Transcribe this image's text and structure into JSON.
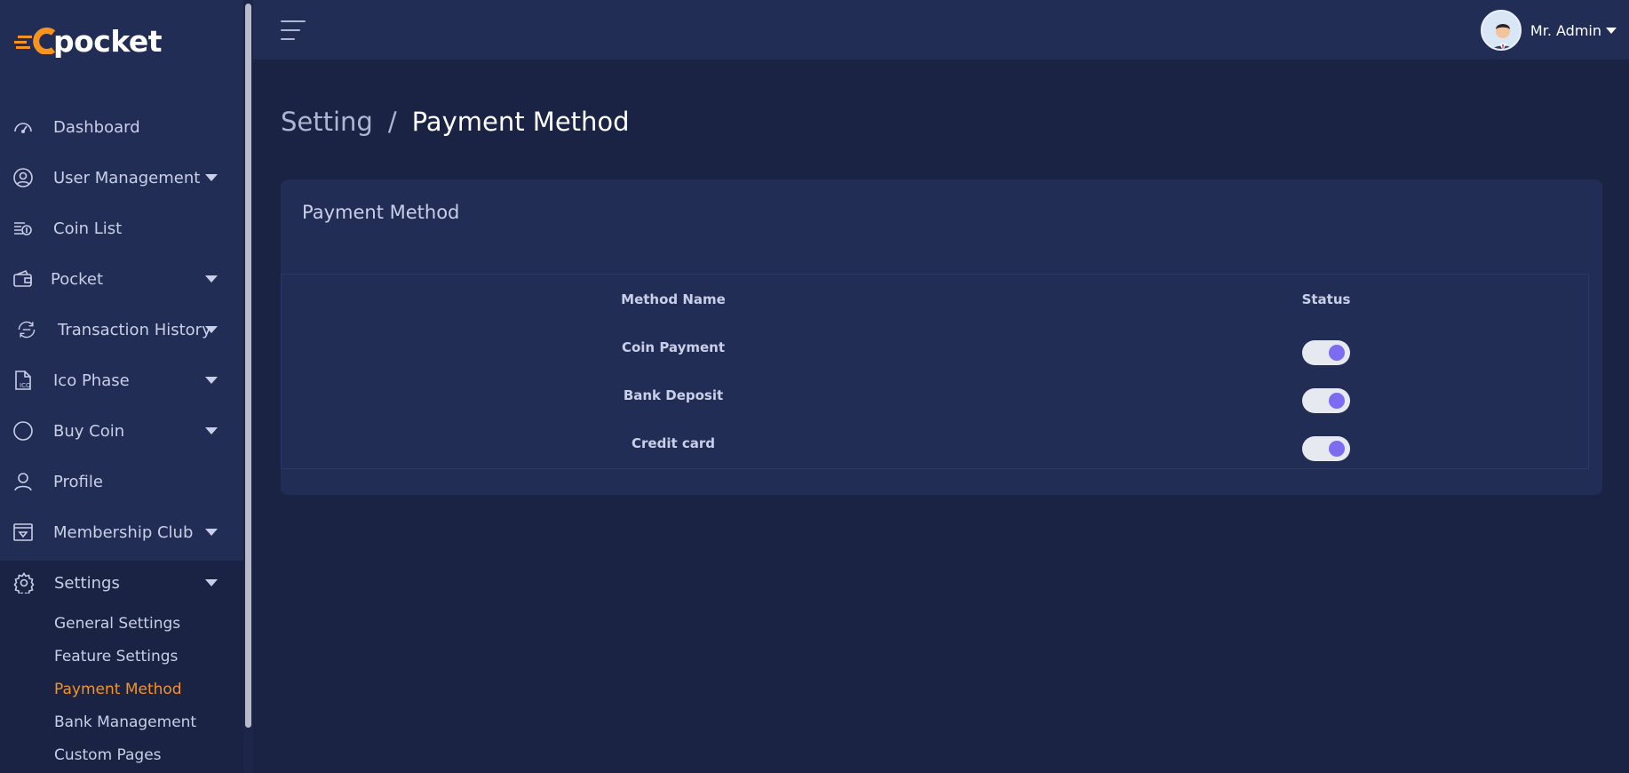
{
  "app": {
    "logo_text": "pocket",
    "accent_color": "#f7931e",
    "toggle_color": "#7c6cf2"
  },
  "sidebar": {
    "items": [
      {
        "label": "Dashboard",
        "icon": "dashboard-icon",
        "has_caret": false
      },
      {
        "label": "User Management",
        "icon": "user-circle-icon",
        "has_caret": true
      },
      {
        "label": "Coin List",
        "icon": "coin-list-icon",
        "has_caret": false
      },
      {
        "label": "Pocket",
        "icon": "wallet-icon",
        "has_caret": true
      },
      {
        "label": "Transaction History",
        "icon": "history-icon",
        "has_caret": true
      },
      {
        "label": "Ico Phase",
        "icon": "ico-document-icon",
        "has_caret": true
      },
      {
        "label": "Buy Coin",
        "icon": "circle-icon",
        "has_caret": true
      },
      {
        "label": "Profile",
        "icon": "user-icon",
        "has_caret": false
      },
      {
        "label": "Membership Club",
        "icon": "diamond-card-icon",
        "has_caret": true
      },
      {
        "label": "Settings",
        "icon": "gear-icon",
        "has_caret": true
      }
    ],
    "settings_submenu": [
      {
        "label": "General Settings",
        "active": false
      },
      {
        "label": "Feature Settings",
        "active": false
      },
      {
        "label": "Payment Method",
        "active": true
      },
      {
        "label": "Bank Management",
        "active": false
      },
      {
        "label": "Custom Pages",
        "active": false
      }
    ]
  },
  "topbar": {
    "user_name": "Mr. Admin"
  },
  "breadcrumb": {
    "parent": "Setting",
    "separator": "/",
    "current": "Payment Method"
  },
  "card": {
    "title": "Payment Method",
    "columns": [
      "Method Name",
      "Status"
    ],
    "rows": [
      {
        "method": "Coin Payment",
        "status_on": true
      },
      {
        "method": "Bank Deposit",
        "status_on": true
      },
      {
        "method": "Credit card",
        "status_on": true
      }
    ]
  }
}
